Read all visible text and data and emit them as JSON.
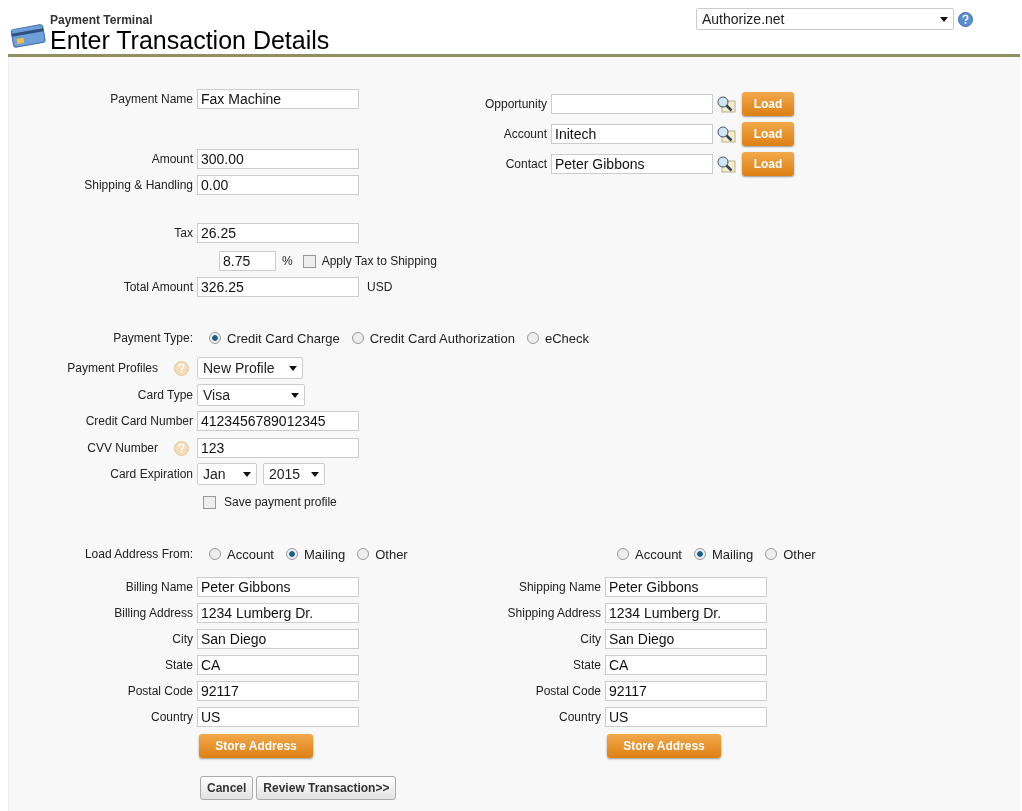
{
  "header": {
    "subtitle": "Payment Terminal",
    "title": "Enter Transaction Details",
    "gateway": "Authorize.net"
  },
  "payment_name": {
    "label": "Payment Name",
    "value": "Fax Machine"
  },
  "amount": {
    "label": "Amount",
    "value": "300.00"
  },
  "shipping_handling": {
    "label": "Shipping & Handling",
    "value": "0.00"
  },
  "tax": {
    "label": "Tax",
    "value": "26.25",
    "percent": "8.75",
    "percent_sign": "%",
    "apply_to_shipping": {
      "label": "Apply Tax to Shipping",
      "checked": false
    }
  },
  "total": {
    "label": "Total Amount",
    "value": "326.25",
    "currency": "USD"
  },
  "lookups": [
    {
      "label": "Opportunity",
      "button": "Load"
    },
    {
      "label": "Account",
      "value": "Initech",
      "button": "Load"
    },
    {
      "label": "Contact",
      "value": "Peter Gibbons",
      "button": "Load"
    }
  ],
  "payment_type": {
    "label": "Payment Type:",
    "options": [
      {
        "label": "Credit Card Charge",
        "selected": true
      },
      {
        "label": "Credit Card Authorization",
        "selected": false
      },
      {
        "label": "eCheck",
        "selected": false
      }
    ]
  },
  "payment_profiles": {
    "label": "Payment Profiles",
    "value": "New Profile"
  },
  "card_type": {
    "label": "Card Type",
    "value": "Visa"
  },
  "card_number": {
    "label": "Credit Card Number",
    "value": "4123456789012345"
  },
  "cvv": {
    "label": "CVV Number",
    "value": "123"
  },
  "expiration": {
    "label": "Card Expiration",
    "month": "Jan",
    "year": "2015"
  },
  "save_profile": {
    "label": "Save payment profile",
    "checked": false
  },
  "addresses": [
    {
      "load_label": "Load Address From:",
      "options": [
        {
          "label": "Account",
          "selected": false
        },
        {
          "label": "Mailing",
          "selected": true
        },
        {
          "label": "Other",
          "selected": false
        }
      ],
      "fields": [
        {
          "label": "Billing Name",
          "value": "Peter Gibbons"
        },
        {
          "label": "Billing Address",
          "value": "1234 Lumberg Dr."
        },
        {
          "label": "City",
          "value": "San Diego"
        },
        {
          "label": "State",
          "value": "CA"
        },
        {
          "label": "Postal Code",
          "value": "92117"
        },
        {
          "label": "Country",
          "value": "US"
        }
      ],
      "button": "Store Address"
    },
    {
      "options": [
        {
          "label": "Account",
          "selected": false
        },
        {
          "label": "Mailing",
          "selected": true
        },
        {
          "label": "Other",
          "selected": false
        }
      ],
      "fields": [
        {
          "label": "Shipping Name",
          "value": "Peter Gibbons"
        },
        {
          "label": "Shipping Address",
          "value": "1234 Lumberg Dr."
        },
        {
          "label": "City",
          "value": "San Diego"
        },
        {
          "label": "State",
          "value": "CA"
        },
        {
          "label": "Postal Code",
          "value": "92117"
        },
        {
          "label": "Country",
          "value": "US"
        }
      ],
      "button": "Store Address"
    }
  ],
  "actions": [
    "Cancel",
    "Review Transaction>>"
  ]
}
